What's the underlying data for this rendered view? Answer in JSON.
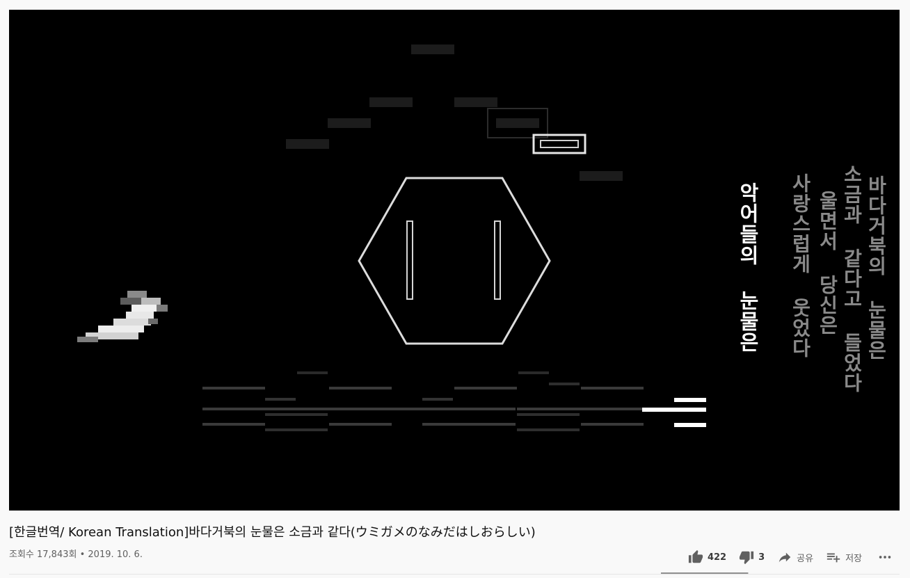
{
  "video": {
    "background_color": "#000000",
    "lyrics": {
      "highlight_line": "악어들의 눈물은",
      "gray_lines": [
        "바다거북의 눈물은",
        "소금과 같다고 들었다",
        "울면서 당신은",
        "사랑스럽게 웃었다"
      ]
    }
  },
  "info": {
    "title": "[한글번역/ Korean Translation]바다거북의 눈물은 소금과 같다(ウミガメのなみだはしおらしい)",
    "views": "조회수 17,843회",
    "separator": " • ",
    "date": "2019. 10. 6."
  },
  "actions": {
    "like_count": "422",
    "dislike_count": "3",
    "share_label": "공유",
    "save_label": "저장",
    "like_ratio": 0.993,
    "icons": {
      "like": "thumbs-up-icon",
      "dislike": "thumbs-down-icon",
      "share": "share-arrow-icon",
      "save": "playlist-add-icon",
      "more": "more-horizontal-icon"
    }
  }
}
